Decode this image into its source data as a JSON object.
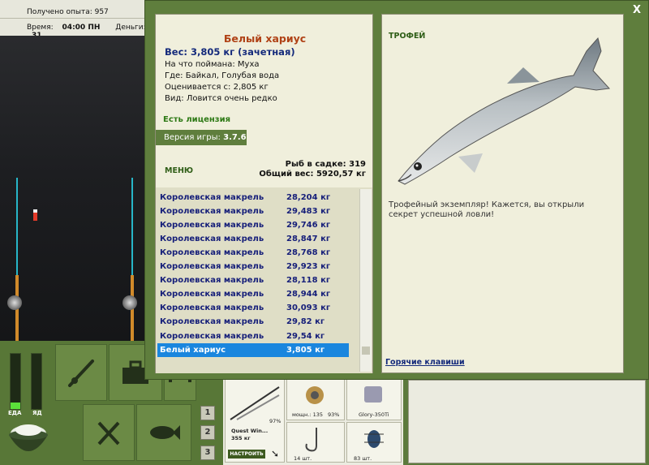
{
  "hud": {
    "experience_label": "Получено опыта: 957",
    "time_label": "Время:",
    "time_value": "04:00 ПН",
    "money_label": "Деньги:",
    "money_value": "31"
  },
  "fish_info": {
    "name": "Белый хариус",
    "weight": "Вес: 3,805 кг (зачетная)",
    "caught_with": "На что поймана: Муха",
    "location": "Где: Байкал, Голубая вода",
    "valued_at": "Оценивается с: 2,805 кг",
    "rarity": "Вид: Ловится очень редко",
    "license": "Есть лицензия",
    "version_label": "Версия игры:",
    "version_value": "3.7.6",
    "menu_label": "МЕНЮ",
    "fish_in_keepnet": "Рыб в садке: 319",
    "total_weight": "Общий вес: 5920,57 кг"
  },
  "catch_list": [
    {
      "name": "Королевская макрель",
      "weight": "28,204 кг",
      "selected": false
    },
    {
      "name": "Королевская макрель",
      "weight": "29,483 кг",
      "selected": false
    },
    {
      "name": "Королевская макрель",
      "weight": "29,746 кг",
      "selected": false
    },
    {
      "name": "Королевская макрель",
      "weight": "28,847 кг",
      "selected": false
    },
    {
      "name": "Королевская макрель",
      "weight": "28,768 кг",
      "selected": false
    },
    {
      "name": "Королевская макрель",
      "weight": "29,923 кг",
      "selected": false
    },
    {
      "name": "Королевская макрель",
      "weight": "28,118 кг",
      "selected": false
    },
    {
      "name": "Королевская макрель",
      "weight": "28,944 кг",
      "selected": false
    },
    {
      "name": "Королевская макрель",
      "weight": "30,093 кг",
      "selected": false
    },
    {
      "name": "Королевская макрель",
      "weight": "29,82 кг",
      "selected": false
    },
    {
      "name": "Королевская макрель",
      "weight": "29,54 кг",
      "selected": false
    },
    {
      "name": "Белый хариус",
      "weight": "3,805 кг",
      "selected": true
    }
  ],
  "trophy": {
    "label": "ТРОФЕЙ",
    "message": "Трофейный экземпляр! Кажется, вы открыли секрет успешной ловли!",
    "hotkeys_link": "Горячие клавиши"
  },
  "close_label": "X",
  "gauges": {
    "food_label": "ЕДА",
    "food_level": 0.12,
    "poison_label": "ЯД",
    "poison_level": 0.0
  },
  "slot_buttons": [
    "1",
    "2",
    "3"
  ],
  "inventory": {
    "rod_percent": "97%",
    "rod_name": "Quest Win...",
    "rod_length": "355 кг",
    "configure_button": "НАСТРОИТЬ",
    "reel_power": "мощн.: 135",
    "reel_percent": "93%",
    "line_name": "Glory-350Ti",
    "hooks_count": "14 шт.",
    "bait_count": "83 шт."
  }
}
